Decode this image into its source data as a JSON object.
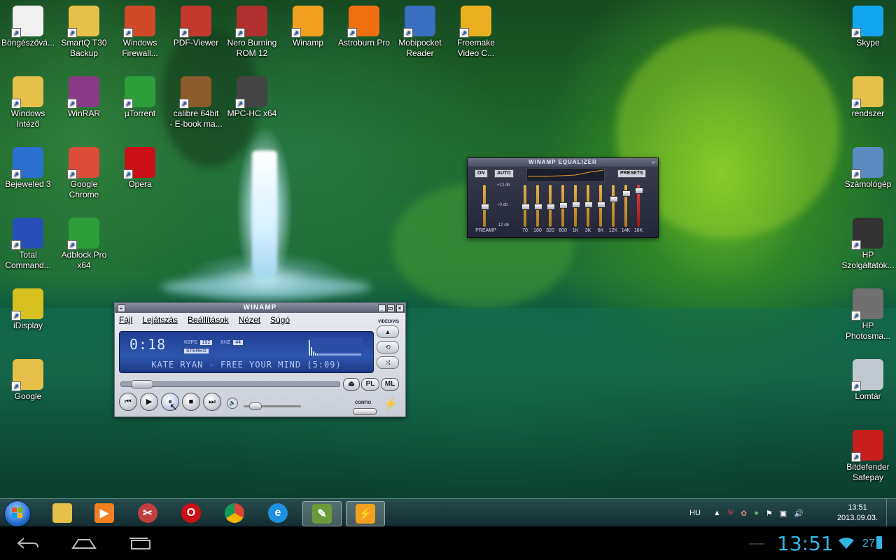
{
  "desktop": {
    "icons_left": [
      {
        "label": "Böngészővá...",
        "icon": "browser-list-icon",
        "color": "#f0f0f0"
      },
      {
        "label": "SmartQ T30\nBackup",
        "icon": "folder-icon",
        "color": "#e5c04a"
      },
      {
        "label": "Windows\nFirewall...",
        "icon": "shield-icon",
        "color": "#d04a2a"
      },
      {
        "label": "PDF-Viewer",
        "icon": "pdf-icon",
        "color": "#c0392b"
      },
      {
        "label": "Nero Burning\nROM 12",
        "icon": "nero-icon",
        "color": "#b03030"
      },
      {
        "label": "Winamp",
        "icon": "winamp-icon",
        "color": "#f2a020"
      },
      {
        "label": "Astroburn Pro",
        "icon": "astroburn-icon",
        "color": "#f07010"
      },
      {
        "label": "Mobipocket\nReader",
        "icon": "book-icon",
        "color": "#3a6ec0"
      },
      {
        "label": "Freemake\nVideo C...",
        "icon": "freemake-icon",
        "color": "#e8b020"
      },
      {
        "label": "Windows\nIntéző",
        "icon": "explorer-icon",
        "color": "#e5c04a"
      },
      {
        "label": "WinRAR",
        "icon": "winrar-icon",
        "color": "#8b3a8a"
      },
      {
        "label": "µTorrent",
        "icon": "utorrent-icon",
        "color": "#2e9e3a"
      },
      {
        "label": "calibre 64bit\n- E-book ma...",
        "icon": "calibre-icon",
        "color": "#8a5a2a"
      },
      {
        "label": "MPC-HC x64",
        "icon": "mpc-icon",
        "color": "#444444"
      },
      {
        "label": "Bejeweled 3",
        "icon": "bejeweled-icon",
        "color": "#2b6fd0"
      },
      {
        "label": "Google\nChrome",
        "icon": "chrome-icon",
        "color": "#dd4b39"
      },
      {
        "label": "Opera",
        "icon": "opera-icon",
        "color": "#cc0f16"
      },
      {
        "label": "Total\nCommand...",
        "icon": "floppy-icon",
        "color": "#2850b8"
      },
      {
        "label": "Adblock Pro\nx64",
        "icon": "adblock-icon",
        "color": "#2e9e3a"
      },
      {
        "label": "iDisplay",
        "icon": "idisplay-icon",
        "color": "#d8c020"
      },
      {
        "label": "Google",
        "icon": "folder-icon",
        "color": "#e5c04a"
      }
    ],
    "icons_right": [
      {
        "label": "Skype",
        "icon": "skype-icon",
        "color": "#12a5f0"
      },
      {
        "label": "rendszer",
        "icon": "folder-icon",
        "color": "#e5c04a"
      },
      {
        "label": "Számológép",
        "icon": "calculator-icon",
        "color": "#5a8ac0"
      },
      {
        "label": "HP\nSzolgáltatók...",
        "icon": "hp-icon",
        "color": "#333333"
      },
      {
        "label": "HP\nPhotosma...",
        "icon": "camera-icon",
        "color": "#707070"
      },
      {
        "label": "Lomtár",
        "icon": "recycle-bin-icon",
        "color": "#c0c8d0"
      },
      {
        "label": "Bitdefender\nSafepay",
        "icon": "bitdefender-icon",
        "color": "#c81e1e"
      }
    ]
  },
  "winamp": {
    "title": "WINAMP",
    "menu": [
      "Fájl",
      "Lejátszás",
      "Beállítások",
      "Nézet",
      "Súgó"
    ],
    "time": "0:18",
    "kbps_label": "KBPS",
    "kbps": "192",
    "khz_label": "KHZ",
    "khz": "44",
    "stereo": "STEREO",
    "song": "KATE RYAN - FREE YOUR MIND (5:09)",
    "video_vis": "VIDEO/VIS",
    "pl": "PL",
    "ml": "ML",
    "config": "CONFIG",
    "seek_position": 0.06,
    "volume": 0.3
  },
  "equalizer": {
    "title": "WINAMP EQUALIZER",
    "on": "ON",
    "auto": "AUTO",
    "presets": "PRESETS",
    "db_top": "+12 db",
    "db_mid": "+0 db",
    "db_bot": "-12 db",
    "preamp": "PREAMP",
    "bands": [
      {
        "label": "70",
        "level": 0.5
      },
      {
        "label": "180",
        "level": 0.5
      },
      {
        "label": "320",
        "level": 0.5
      },
      {
        "label": "600",
        "level": 0.52
      },
      {
        "label": "1K",
        "level": 0.55
      },
      {
        "label": "3K",
        "level": 0.55
      },
      {
        "label": "6K",
        "level": 0.55
      },
      {
        "label": "12K",
        "level": 0.7
      },
      {
        "label": "14K",
        "level": 0.85
      },
      {
        "label": "16K",
        "level": 0.93
      }
    ],
    "preamp_level": 0.5
  },
  "taskbar": {
    "language": "HU",
    "time": "13:51",
    "date": "2013.09.03."
  },
  "android": {
    "time": "13:51",
    "battery": "27"
  }
}
